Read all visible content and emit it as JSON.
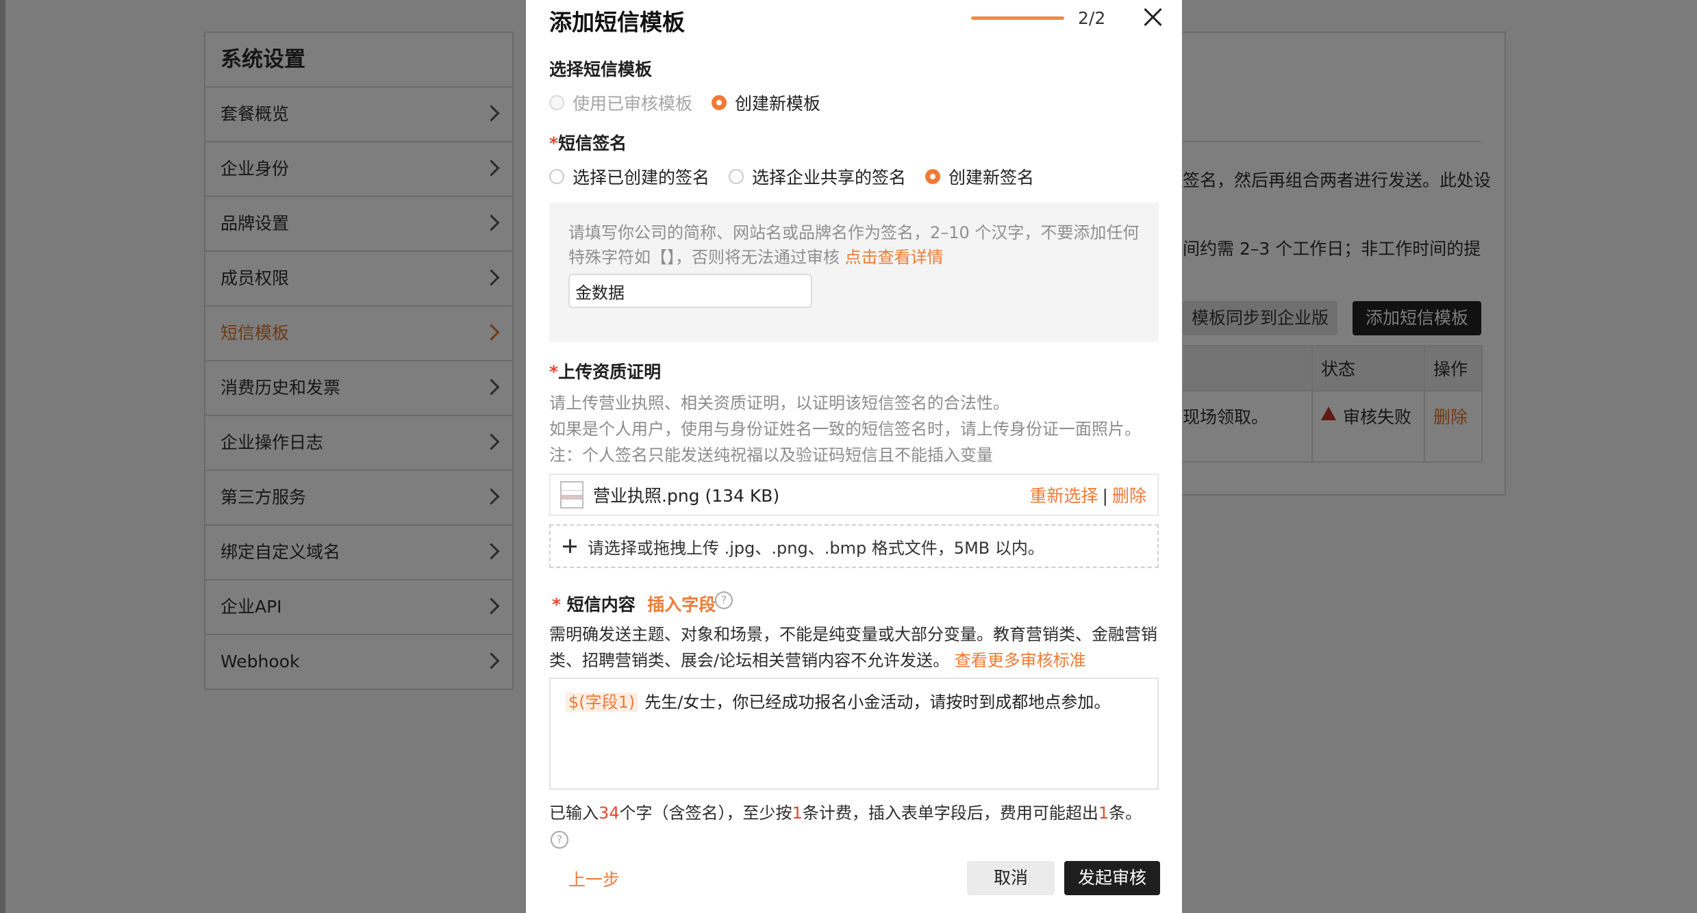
{
  "sidebar": {
    "title": "系统设置",
    "items": [
      {
        "label": "套餐概览"
      },
      {
        "label": "企业身份"
      },
      {
        "label": "品牌设置"
      },
      {
        "label": "成员权限"
      },
      {
        "label": "短信模板",
        "active": true
      },
      {
        "label": "消费历史和发票"
      },
      {
        "label": "企业操作日志"
      },
      {
        "label": "第三方服务"
      },
      {
        "label": "绑定自定义域名"
      },
      {
        "label": "企业API"
      },
      {
        "label": "Webhook"
      }
    ]
  },
  "background": {
    "line1": "签名，然后再组合两者进行发送。此处设",
    "line2": "间约需 2–3 个工作日；非工作时间的提",
    "sync_button": "模板同步到企业版",
    "add_button": "添加短信模板",
    "table": {
      "headers": [
        "状态",
        "操作"
      ],
      "row_text": "现场领取。",
      "status": "审核失败",
      "action": "删除"
    }
  },
  "modal": {
    "title": "添加短信模板",
    "step": "2/2",
    "progress_fraction": 1.0,
    "template_section": {
      "label": "选择短信模板",
      "options": [
        "使用已审核模板",
        "创建新模板"
      ],
      "selected": "创建新模板"
    },
    "signature_section": {
      "label": "短信签名",
      "options": [
        "选择已创建的签名",
        "选择企业共享的签名",
        "创建新签名"
      ],
      "selected": "创建新签名",
      "hint": "请填写你公司的简称、网站名或品牌名作为签名，2–10 个汉字，不要添加任何特殊字符如【】，否则将无法通过审核",
      "hint_link": "点击查看详情",
      "input_value": "金数据"
    },
    "qualification_section": {
      "label": "上传资质证明",
      "desc_line1": "请上传营业执照、相关资质证明，以证明该短信签名的合法性。",
      "desc_line2": "如果是个人用户，使用与身份证姓名一致的短信签名时，请上传身份证一面照片。",
      "desc_line3": "注：个人签名只能发送纯祝福以及验证码短信且不能插入变量",
      "file_name": "营业执照.png",
      "file_size": "(134 KB)",
      "reselect": "重新选择",
      "separator": "|",
      "delete": "删除",
      "upload_hint": "请选择或拖拽上传 .jpg、.png、.bmp 格式文件，5MB 以内。"
    },
    "content_section": {
      "label": "短信内容",
      "insert_field": "插入字段",
      "desc": "需明确发送主题、对象和场景，不能是纯变量或大部分变量。教育营销类、金融营销类、招聘营销类、展会/论坛相关营销内容不允许发送。",
      "desc_link": "查看更多审核标准",
      "field_chip": "$(字段1)",
      "message": "先生/女士，你已经成功报名小金活动，请按时到成都地点参加。",
      "count_prefix": "已输入",
      "count_chars": "34",
      "count_mid1": "个字（含签名），至少按",
      "count_min": "1",
      "count_mid2": "条计费，插入表单字段后，费用可能超出",
      "count_max": "1",
      "count_suffix": "条。"
    },
    "footer": {
      "prev": "上一步",
      "cancel": "取消",
      "submit": "发起审核"
    }
  },
  "colors": {
    "accent": "#f07a35",
    "required": "#e8452c",
    "dark_button": "#1e1e1e",
    "overlay": "#7b7b7b"
  }
}
